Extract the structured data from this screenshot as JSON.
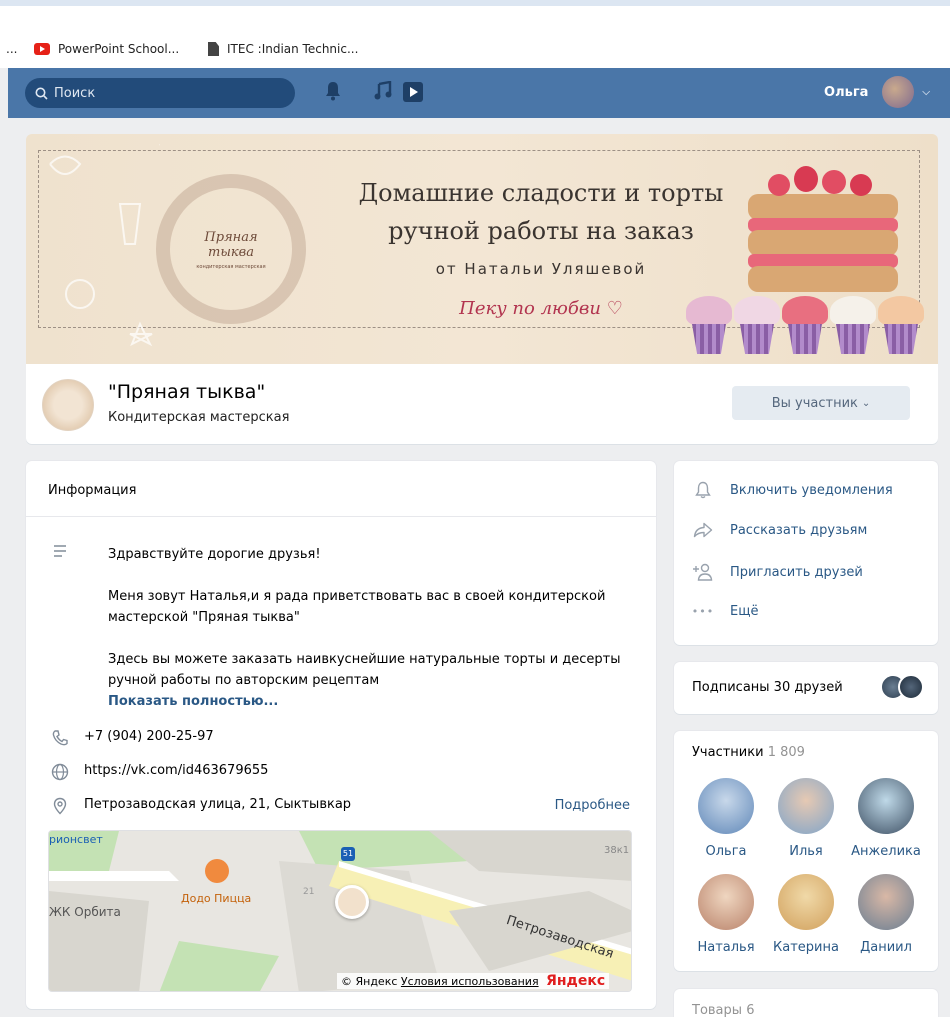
{
  "bookmarks": [
    {
      "label": "...",
      "icon": "ellipsis"
    },
    {
      "label": "PowerPoint School...",
      "icon": "youtube-icon"
    },
    {
      "label": "ITEC :Indian Technic...",
      "icon": "document-icon"
    }
  ],
  "header": {
    "search_placeholder": "Поиск",
    "user_name": "Ольга",
    "brand_color": "#4a76a8"
  },
  "cover": {
    "title_line1": "Домашние сладости и торты",
    "title_line2": "ручной работы на заказ",
    "from": "от Натальи Уляшевой",
    "script": "Пеку по любви",
    "logo_line1": "Пряная",
    "logo_line2": "тыква",
    "logo_sub": "кондитерская мастерская"
  },
  "group": {
    "name": "\"Пряная тыква\"",
    "subtitle": "Кондитерская мастерская",
    "member_button": "Вы участник"
  },
  "info": {
    "heading": "Информация",
    "greeting": "Здравствуйте дорогие друзья!",
    "para1": "Меня зовут Наталья,и я рада приветствовать вас в своей кондитерской мастерской \"Пряная тыква\"",
    "para2": "Здесь вы можете заказать наивкуснейшие натуральные торты и десерты ручной работы по авторским рецептам",
    "show_more": "Показать полностью...",
    "phone": "+7 (904) 200-25-97",
    "site": "https://vk.com/id463679655",
    "address": "Петрозаводская улица, 21, Сыктывкар",
    "details": "Подробнее"
  },
  "map": {
    "label_top_left": "рионсвет",
    "label_bus": "38к1",
    "label_pizza": "Додо Пицца",
    "label_orbita": "ЖК Орбита",
    "label_street": "Петрозаводская",
    "label_num": "21",
    "label_stop": "51",
    "copyright": "© Яндекс",
    "terms": "Условия использования",
    "brand": "Яндекс"
  },
  "actions": [
    {
      "label": "Включить уведомления",
      "icon": "bell-icon"
    },
    {
      "label": "Рассказать друзьям",
      "icon": "share-icon"
    },
    {
      "label": "Пригласить друзей",
      "icon": "invite-icon"
    },
    {
      "label": "Ещё",
      "icon": "more-icon"
    }
  ],
  "friends": {
    "label": "Подписаны 30 друзей"
  },
  "members": {
    "title": "Участники",
    "count": "1 809",
    "list": [
      {
        "name": "Ольга",
        "color": "#5f87b8"
      },
      {
        "name": "Илья",
        "color": "#7fa4c9"
      },
      {
        "name": "Анжелика",
        "color": "#3d4f63"
      },
      {
        "name": "Наталья",
        "color": "#b9826a"
      },
      {
        "name": "Катерина",
        "color": "#d1a05c"
      },
      {
        "name": "Даниил",
        "color": "#6a7e92"
      }
    ]
  },
  "goods": {
    "title": "Товары",
    "count": "6"
  }
}
